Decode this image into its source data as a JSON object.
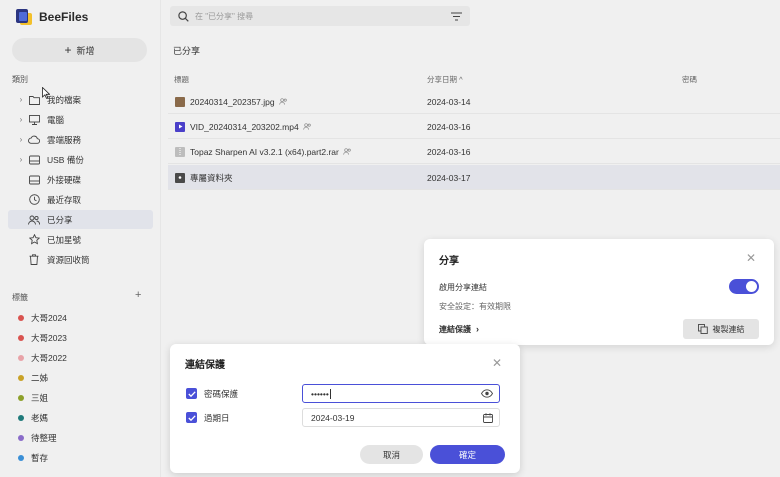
{
  "app": {
    "name": "BeeFiles"
  },
  "sidebar": {
    "new_label": "新增",
    "categories_label": "類別",
    "tags_label": "標籤",
    "add_tag_symbol": "+",
    "items": [
      {
        "label": "我的檔案",
        "icon": "folder-icon",
        "expandable": true
      },
      {
        "label": "電腦",
        "icon": "monitor-icon",
        "expandable": true
      },
      {
        "label": "雲端服務",
        "icon": "cloud-icon",
        "expandable": true
      },
      {
        "label": "USB 備份",
        "icon": "drive-icon",
        "expandable": true
      },
      {
        "label": "外接硬碟",
        "icon": "drive-icon",
        "expandable": false
      },
      {
        "label": "最近存取",
        "icon": "clock-icon",
        "expandable": false
      },
      {
        "label": "已分享",
        "icon": "people-icon",
        "expandable": false,
        "active": true
      },
      {
        "label": "已加星號",
        "icon": "star-icon",
        "expandable": false
      },
      {
        "label": "資源回收筒",
        "icon": "trash-icon",
        "expandable": false
      }
    ],
    "tags": [
      {
        "label": "大哥2024",
        "color": "#d9534f"
      },
      {
        "label": "大哥2023",
        "color": "#d9534f"
      },
      {
        "label": "大哥2022",
        "color": "#e8a3a8"
      },
      {
        "label": "二姊",
        "color": "#c9a227"
      },
      {
        "label": "三姐",
        "color": "#8da02a"
      },
      {
        "label": "老媽",
        "color": "#1f7a7a"
      },
      {
        "label": "待整理",
        "color": "#8a6cc9"
      },
      {
        "label": "暫存",
        "color": "#3a8fd6"
      }
    ]
  },
  "search": {
    "placeholder": "在 \"已分享\" 搜尋"
  },
  "main": {
    "title": "已分享",
    "columns": {
      "name": "標題",
      "date": "分享日期 ^",
      "password": "密碼"
    },
    "rows": [
      {
        "name": "20240314_202357.jpg",
        "date": "2024-03-14",
        "type": "image",
        "shared": true
      },
      {
        "name": "VID_20240314_203202.mp4",
        "date": "2024-03-16",
        "type": "video",
        "shared": true
      },
      {
        "name": "Topaz Sharpen AI v3.2.1 (x64).part2.rar",
        "date": "2024-03-16",
        "type": "archive",
        "shared": true
      },
      {
        "name": "專屬資料夾",
        "date": "2024-03-17",
        "type": "folder",
        "shared": false,
        "selected": true
      }
    ]
  },
  "share_dialog": {
    "title": "分享",
    "enable_label": "啟用分享連結",
    "enabled": true,
    "security_text": "安全設定：有效期限",
    "link_protection_label": "連結保護",
    "copy_label": "複製連結"
  },
  "link_protection_dialog": {
    "title": "連結保護",
    "password_label": "密碼保護",
    "password_value": "••••••",
    "password_checked": true,
    "expiry_label": "過期日",
    "expiry_value": "2024-03-19",
    "expiry_checked": true,
    "cancel_label": "取消",
    "ok_label": "確定"
  },
  "colors": {
    "accent": "#4a50d8",
    "selected_row": "#e2e3e9"
  }
}
